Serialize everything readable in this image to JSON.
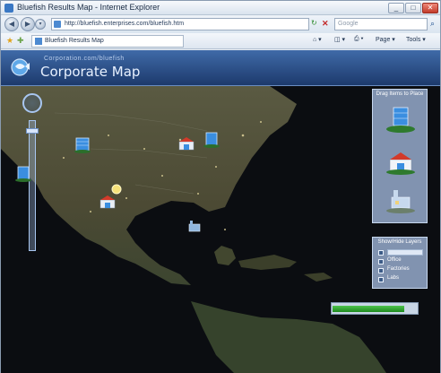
{
  "window": {
    "title": "Bluefish Results Map - Internet Explorer",
    "controls": [
      "_",
      "□",
      "✕"
    ]
  },
  "address_bar": {
    "url": "http://bluefish.enterprises.com/bluefish.htm",
    "search_placeholder": "Google"
  },
  "tab": {
    "label": "Bluefish Results Map"
  },
  "command_bar": {
    "page_label": "Page ▾",
    "tools_label": "Tools ▾"
  },
  "app": {
    "subtitle": "Corporation.com/bluefish",
    "title": "Corporate Map"
  },
  "zoom": {
    "level_fraction": 0.05
  },
  "legend_panel": {
    "title": "Drag Items to Place",
    "items": [
      {
        "icon": "blue-building-icon",
        "label": ""
      },
      {
        "icon": "red-warehouse-icon",
        "label": ""
      },
      {
        "icon": "factory-icon",
        "label": ""
      }
    ]
  },
  "filter_panel": {
    "title": "Show/Hide Layers",
    "options": [
      {
        "label": "",
        "checked": false
      },
      {
        "label": "Office",
        "checked": true
      },
      {
        "label": "Factories",
        "checked": true
      },
      {
        "label": "Labs",
        "checked": true
      }
    ]
  },
  "status": {
    "progress": 0.85
  },
  "colors": {
    "header": "#2a4d85",
    "panel": "#96acd0",
    "building_blue": "#3a8ee0",
    "warehouse_red": "#d23a2a",
    "progress": "#2fa52f"
  }
}
